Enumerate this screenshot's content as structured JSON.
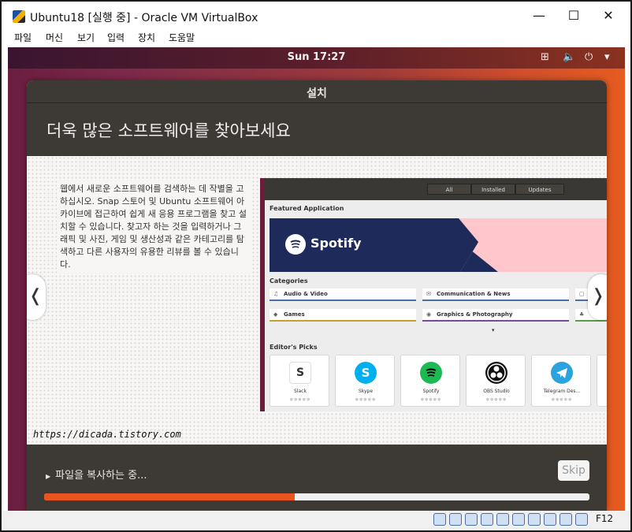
{
  "window": {
    "title": "Ubuntu18 [실행 중] - Oracle VM VirtualBox",
    "minimize": "—",
    "maximize": "☐",
    "close": "✕"
  },
  "menu": [
    "파일",
    "머신",
    "보기",
    "입력",
    "장치",
    "도움말"
  ],
  "topbar": {
    "clock": "Sun 17:27",
    "network": "⊞",
    "volume": "🔈",
    "power": "⏻",
    "dropdown": "▾"
  },
  "installer": {
    "title": "설치",
    "heading": "더욱 많은 소프트웨어를 찾아보세요",
    "body": "웹에서 새로운 소프트웨어를 검색하는 데 작별을 고하십시오. Snap 스토어 및 Ubuntu 소프트웨어 아카이브에 접근하여 쉽게 새 응용 프로그램을 찾고 설치할 수 있습니다. 찾고자 하는 것을 입력하거나 그래픽 및 사진, 게임 및 생산성과 같은 카테고리를 탐색하고 다른 사용자의 유용한 리뷰를 볼 수 있습니다.",
    "prev": "❬",
    "next": "❭",
    "status": "파일을 복사하는 중...",
    "status_arrow": "▶",
    "skip": "Skip",
    "progress": 0.46
  },
  "software_screenshot": {
    "tabs": [
      "All",
      "Installed",
      "Updates"
    ],
    "featured_heading": "Featured Application",
    "featured_app": "Spotify",
    "categories_heading": "Categories",
    "categories": [
      "Audio & Video",
      "Communication & News",
      "Games",
      "Graphics & Photography"
    ],
    "categories_more": "▾",
    "editors_heading": "Editor's Picks",
    "picks": [
      "Slack",
      "Skype",
      "Spotify",
      "OBS Studio",
      "Telegram Des..."
    ]
  },
  "watermark": "https://dicada.tistory.com",
  "statusbar": {
    "host_key": "F12"
  },
  "colors": {
    "accent": "#e95420",
    "header": "#3d3a36",
    "aubergine": "#6b1e3f"
  }
}
